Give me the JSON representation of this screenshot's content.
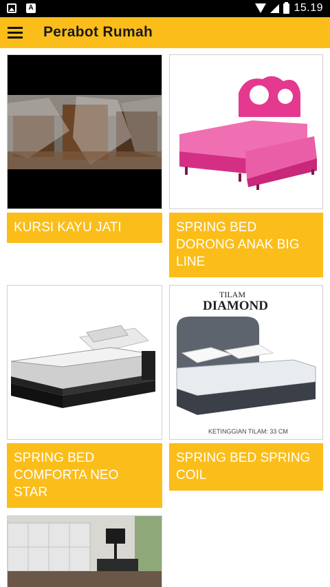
{
  "status_bar": {
    "time": "15.19"
  },
  "app_bar": {
    "title": "Perabot Rumah"
  },
  "products": [
    {
      "name": "KURSI KAYU JATI",
      "image": "wooden-chairs-image"
    },
    {
      "name": "SPRING BED DORONG ANAK BIG LINE",
      "image": "pink-kids-bed-image"
    },
    {
      "name": "SPRING BED COMFORTA NEO STAR",
      "image": "comforta-bed-image"
    },
    {
      "name": "SPRING BED SPRING COIL",
      "image": "diamond-bed-image",
      "brand_small": "TILAM",
      "brand_big": "DIAMOND",
      "caption": "KETINGGIAN TILAM: 33 CM"
    },
    {
      "name": "",
      "image": "headboard-bed-image"
    }
  ]
}
